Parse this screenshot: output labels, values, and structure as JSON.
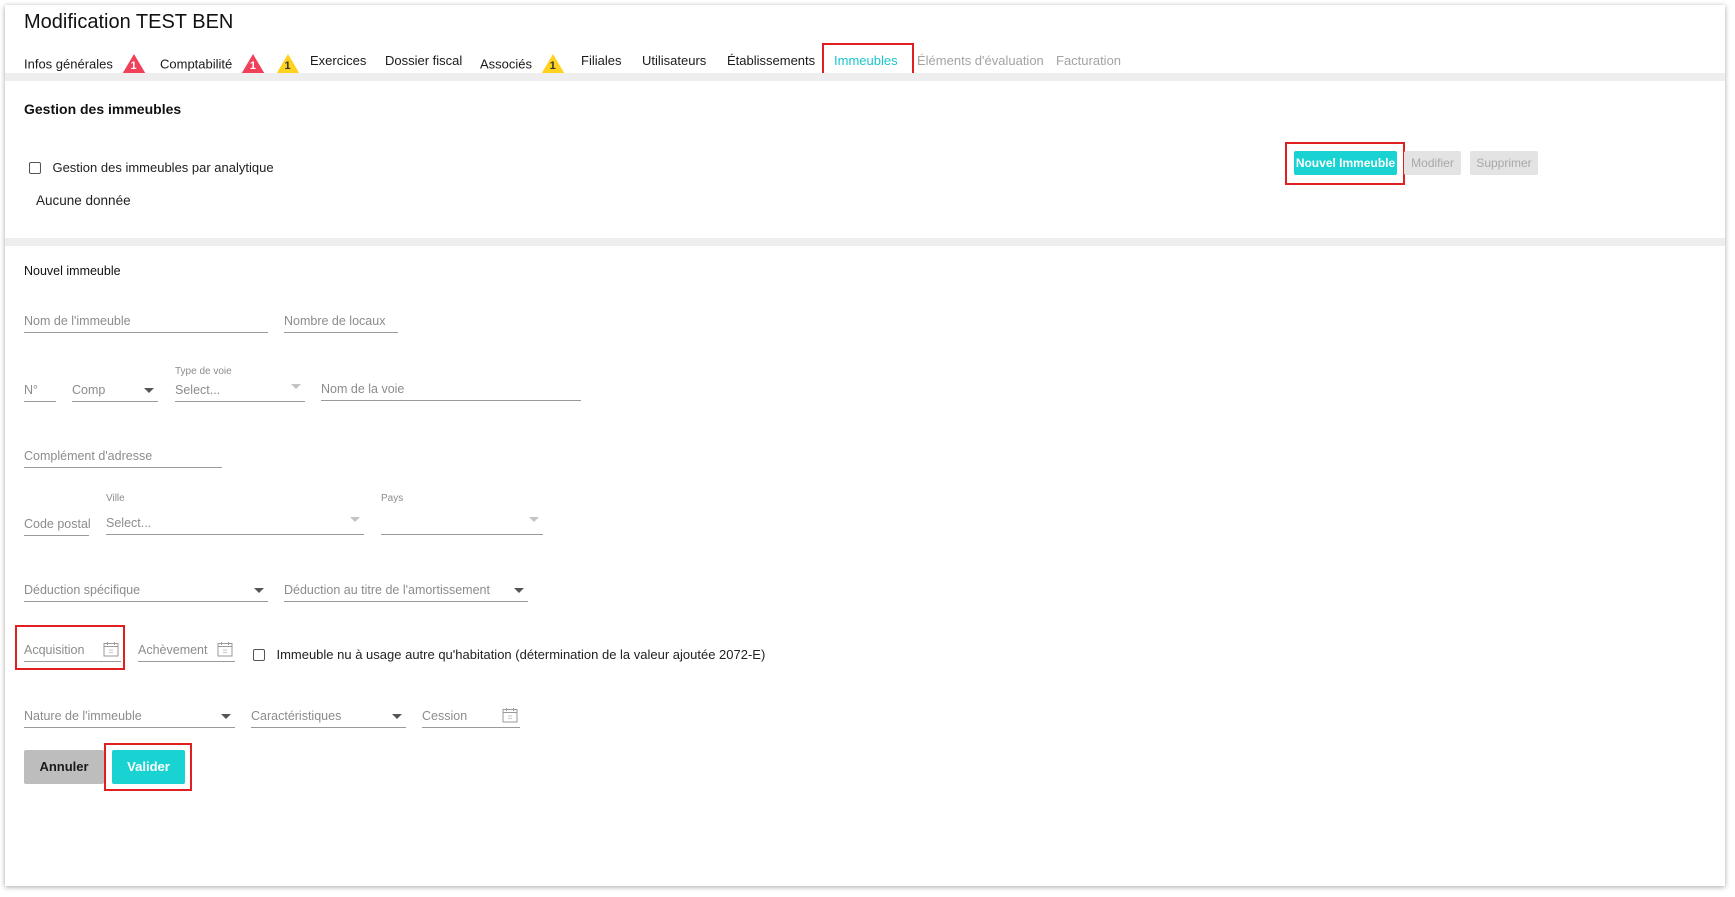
{
  "page": {
    "title": "Modification TEST BEN"
  },
  "tabs": [
    {
      "label": "Infos générales"
    },
    {
      "label": "Comptabilité"
    },
    {
      "label": "Exercices"
    },
    {
      "label": "Dossier fiscal"
    },
    {
      "label": "Associés"
    },
    {
      "label": "Filiales"
    },
    {
      "label": "Utilisateurs"
    },
    {
      "label": "Établissements"
    },
    {
      "label": "Immeubles"
    },
    {
      "label": "Éléments d'évaluation"
    },
    {
      "label": "Facturation"
    }
  ],
  "badges": {
    "infos_red": "1",
    "compta_red": "1",
    "compta_yellow": "1",
    "associes_yellow": "1"
  },
  "colors": {
    "accent": "#19d2d2",
    "badge_red": "#f0405a",
    "badge_yellow": "#ffd21f",
    "highlight": "#e02020"
  },
  "gestion": {
    "title": "Gestion des immeubles",
    "checkbox_label": "Gestion des immeubles par analytique",
    "empty_text": "Aucune donnée",
    "new_button": "Nouvel Immeuble",
    "edit_button": "Modifier",
    "delete_button": "Supprimer"
  },
  "form": {
    "title": "Nouvel immeuble",
    "nom_immeuble": "Nom de l'immeuble",
    "nombre_locaux": "Nombre de locaux",
    "numero": "N°",
    "comp": "Comp",
    "type_voie_label": "Type de voie",
    "type_voie_placeholder": "Select...",
    "nom_voie": "Nom de la voie",
    "complement_adresse": "Complément d'adresse",
    "code_postal": "Code postal",
    "ville_label": "Ville",
    "ville_placeholder": "Select...",
    "pays_label": "Pays",
    "deduction_specifique": "Déduction spécifique",
    "deduction_amortissement": "Déduction au titre de l'amortissement",
    "acquisition": "Acquisition",
    "achevement": "Achèvement",
    "immeuble_nu_label": "Immeuble nu à usage autre qu'habitation (détermination de la valeur ajoutée 2072-E)",
    "nature_immeuble": "Nature de l'immeuble",
    "caracteristiques": "Caractéristiques",
    "cession": "Cession",
    "cancel_button": "Annuler",
    "submit_button": "Valider"
  }
}
